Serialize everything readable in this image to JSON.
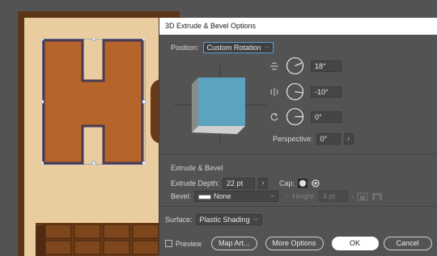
{
  "canvas": {
    "letter": "H"
  },
  "dialog": {
    "title": "3D Extrude & Bevel Options",
    "position": {
      "label": "Position:",
      "value": "Custom Rotation"
    },
    "rotation": {
      "x": {
        "icon": "rotate-x-axis-icon",
        "value": "18°"
      },
      "y": {
        "icon": "rotate-y-axis-icon",
        "value": "-10°"
      },
      "z": {
        "icon": "rotate-z-axis-icon",
        "value": "0°"
      }
    },
    "perspective": {
      "label": "Perspective:",
      "value": "0°"
    },
    "extrude_bevel": {
      "title": "Extrude & Bevel",
      "depth_label": "Extrude Depth:",
      "depth_value": "22 pt",
      "cap_label": "Cap:",
      "bevel_label": "Bevel:",
      "bevel_value": "None",
      "height_label": "Height:",
      "height_value": "4 pt"
    },
    "surface": {
      "label": "Surface:",
      "value": "Plastic Shading"
    },
    "footer": {
      "preview_label": "Preview",
      "map_art": "Map Art...",
      "more_options": "More Options",
      "ok": "OK",
      "cancel": "Cancel"
    }
  },
  "colors": {
    "cube_face": "#5ba3bf",
    "letter_fill": "#b5642a",
    "accent": "#5b9bd8"
  }
}
